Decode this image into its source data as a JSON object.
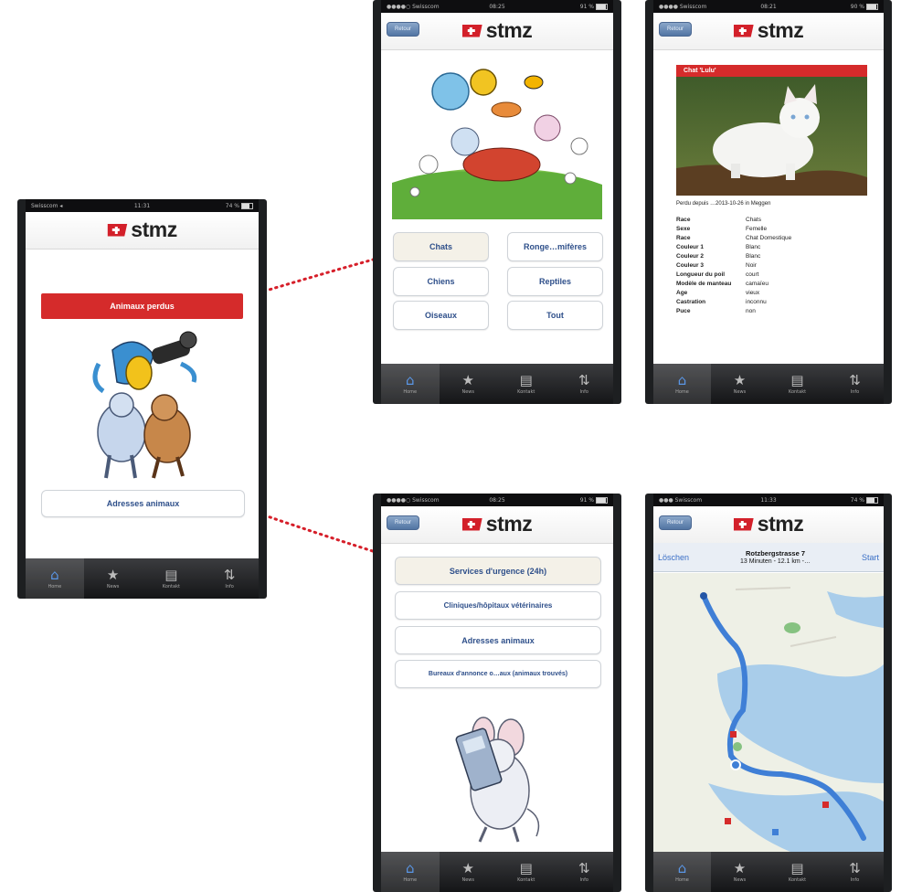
{
  "status": {
    "carrier": "Swisscom",
    "screens": {
      "home": {
        "time": "11:31",
        "battery": "74 %"
      },
      "categories": {
        "time": "08:25",
        "battery": "91 %"
      },
      "detail": {
        "time": "08:21",
        "battery": "90 %"
      },
      "services": {
        "time": "08:25",
        "battery": "91 %"
      },
      "map": {
        "time": "11:33",
        "battery": "74 %"
      }
    }
  },
  "app": {
    "logo_text": "stmz",
    "back_label": "Retour"
  },
  "tabs": [
    {
      "label": "Home",
      "icon": "home-icon"
    },
    {
      "label": "News",
      "icon": "star-icon"
    },
    {
      "label": "Kontakt",
      "icon": "contact-icon"
    },
    {
      "label": "Info",
      "icon": "info-icon"
    }
  ],
  "home": {
    "lost_animals_button": "Animaux perdus",
    "animal_addresses_button": "Adresses animaux"
  },
  "categories": {
    "buttons": [
      "Chats",
      "Ronge…mifères",
      "Chiens",
      "Reptiles",
      "Oiseaux",
      "Tout"
    ]
  },
  "detail": {
    "title": "Chat 'Lulu'",
    "lost_since": "Perdu depuis …2013-10-26 in Meggen",
    "rows": [
      {
        "key": "Race",
        "value": "Chats"
      },
      {
        "key": "Sexe",
        "value": "Femelle"
      },
      {
        "key": "Race",
        "value": "Chat Domestique"
      },
      {
        "key": "Couleur 1",
        "value": "Blanc"
      },
      {
        "key": "Couleur 2",
        "value": "Blanc"
      },
      {
        "key": "Couleur 3",
        "value": "Noir"
      },
      {
        "key": "Longueur du poil",
        "value": "court"
      },
      {
        "key": "Modèle de manteau",
        "value": "camaïeu"
      },
      {
        "key": "Age",
        "value": "vieux"
      },
      {
        "key": "Castration",
        "value": "inconnu"
      },
      {
        "key": "Puce",
        "value": "non"
      }
    ]
  },
  "services": {
    "buttons": [
      "Services d'urgence (24h)",
      "Cliniques/hôpitaux vétérinaires",
      "Adresses animaux",
      "Bureaux d'annonce o…aux (animaux trouvés)"
    ]
  },
  "map": {
    "clear_label": "Löschen",
    "start_label": "Start",
    "destination": "Rotzbergstrasse 7",
    "route_summary": "13 Minuten - 12.1 km -…",
    "colors": {
      "land": "#eef0e6",
      "water": "#a9cdea",
      "route": "#3f7fd6",
      "park": "#86c281"
    }
  },
  "colors": {
    "brand_red": "#d52b2b",
    "button_text": "#2e4f8a",
    "arrow": "#d61f2a",
    "tabbar": "#1e1f22"
  }
}
